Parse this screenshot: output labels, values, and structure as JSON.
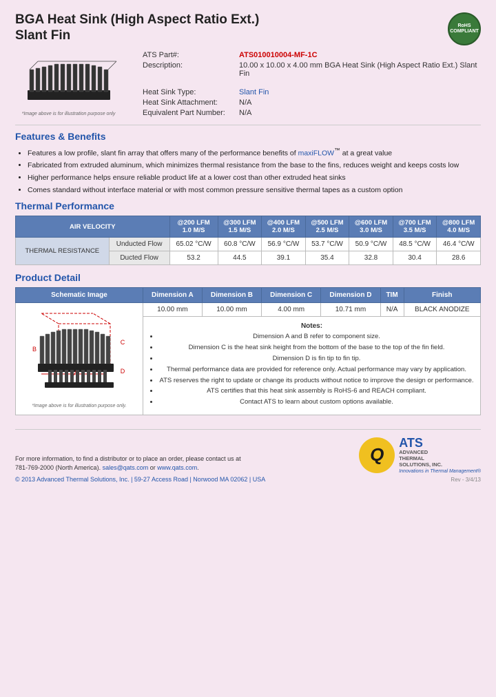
{
  "header": {
    "title_line1": "BGA Heat Sink (High Aspect Ratio Ext.)",
    "title_line2": "Slant Fin",
    "rohs_line1": "RoHS",
    "rohs_line2": "COMPLIANT"
  },
  "part_info": {
    "part_label": "ATS Part#:",
    "part_number": "ATS010010004-MF-1C",
    "description_label": "Description:",
    "description_value": "10.00 x 10.00 x 4.00 mm  BGA Heat Sink (High Aspect Ratio Ext.) Slant Fin",
    "type_label": "Heat Sink Type:",
    "type_value": "Slant Fin",
    "attachment_label": "Heat Sink Attachment:",
    "attachment_value": "N/A",
    "equiv_label": "Equivalent Part Number:",
    "equiv_value": "N/A"
  },
  "image_caption": "*Image above is for illustration purpose only",
  "features": {
    "title": "Features & Benefits",
    "items": [
      "Features a low profile, slant fin array that offers many of the performance benefits of maxiFLOW™ at a great value",
      "Fabricated from extruded aluminum, which minimizes thermal resistance from the base to the fins, reduces weight and keeps costs low",
      "Higher performance helps ensure reliable product life at a lower cost than other extruded heat sinks",
      "Comes standard without interface material or with most common pressure sensitive thermal tapes as a custom option"
    ]
  },
  "thermal_performance": {
    "title": "Thermal Performance",
    "table": {
      "col_headers": [
        "AIR VELOCITY",
        "@200 LFM\n1.0 M/S",
        "@300 LFM\n1.5 M/S",
        "@400 LFM\n2.0 M/S",
        "@500 LFM\n2.5 M/S",
        "@600 LFM\n3.0 M/S",
        "@700 LFM\n3.5 M/S",
        "@800 LFM\n4.0 M/S"
      ],
      "row_header": "THERMAL RESISTANCE",
      "rows": [
        {
          "label": "Unducted Flow",
          "values": [
            "65.02 °C/W",
            "60.8 °C/W",
            "56.9 °C/W",
            "53.7 °C/W",
            "50.9 °C/W",
            "48.5 °C/W",
            "46.4 °C/W"
          ]
        },
        {
          "label": "Ducted Flow",
          "values": [
            "53.2",
            "44.5",
            "39.1",
            "35.4",
            "32.8",
            "30.4",
            "28.6"
          ]
        }
      ]
    }
  },
  "product_detail": {
    "title": "Product Detail",
    "table_headers": [
      "Schematic Image",
      "Dimension A",
      "Dimension B",
      "Dimension C",
      "Dimension D",
      "TIM",
      "Finish"
    ],
    "dimension_values": [
      "10.00 mm",
      "10.00 mm",
      "4.00 mm",
      "10.71 mm",
      "N/A",
      "BLACK ANODIZE"
    ],
    "notes_title": "Notes:",
    "notes": [
      "Dimension A and B refer to component size.",
      "Dimension C is the heat sink height from the bottom of the base to the top of the fin field.",
      "Dimension D is fin tip to fin tip.",
      "Thermal performance data are provided for reference only. Actual performance may vary by application.",
      "ATS reserves the right to update or change its products without notice to improve the design or performance.",
      "ATS certifies that this heat sink assembly is RoHS-6 and REACH compliant.",
      "Contact ATS to learn about custom options available."
    ],
    "schematic_caption": "*Image above is for illustration purpose only."
  },
  "footer": {
    "contact_text": "For more information, to find a distributor or to place an order, please contact us at",
    "phone": "781-769-2000 (North America)",
    "email": "sales@qats.com",
    "website": "www.qats.com",
    "address": "59-27 Access Road  |  Norwood MA  02062  |  USA",
    "copyright": "© 2013 Advanced Thermal Solutions, Inc.",
    "page_number": "Rev - 3/4/13",
    "ats_letter": "Q",
    "ats_main": "ATS",
    "ats_sub1": "ADVANCED",
    "ats_sub2": "THERMAL",
    "ats_sub3": "SOLUTIONS, INC.",
    "ats_tagline": "Innovations in Thermal Management®"
  }
}
